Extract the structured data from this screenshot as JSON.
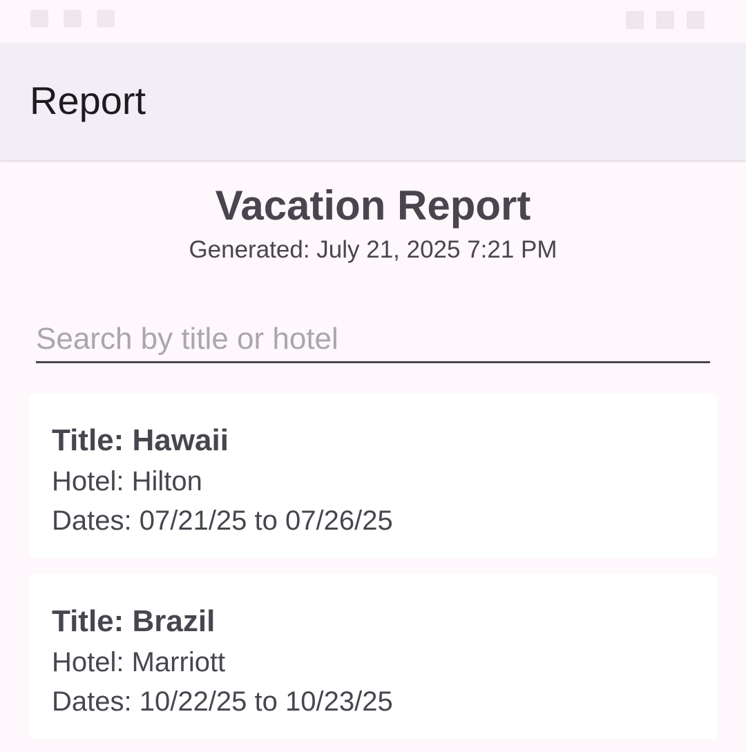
{
  "app_bar": {
    "title": "Report"
  },
  "report": {
    "title": "Vacation Report",
    "generated": "Generated: July 21, 2025 7:21 PM"
  },
  "search": {
    "placeholder": "Search by title or hotel",
    "value": ""
  },
  "vacations": [
    {
      "title": "Title: Hawaii",
      "hotel": "Hotel: Hilton",
      "dates": "Dates: 07/21/25 to 07/26/25"
    },
    {
      "title": "Title: Brazil",
      "hotel": "Hotel: Marriott",
      "dates": "Dates: 10/22/25 to 10/23/25"
    }
  ],
  "colors": {
    "background": "#fef7fb",
    "app_bar": "#f2eef6",
    "text_primary": "#1d1b20",
    "text_secondary": "#49454f",
    "card": "#ffffff"
  }
}
